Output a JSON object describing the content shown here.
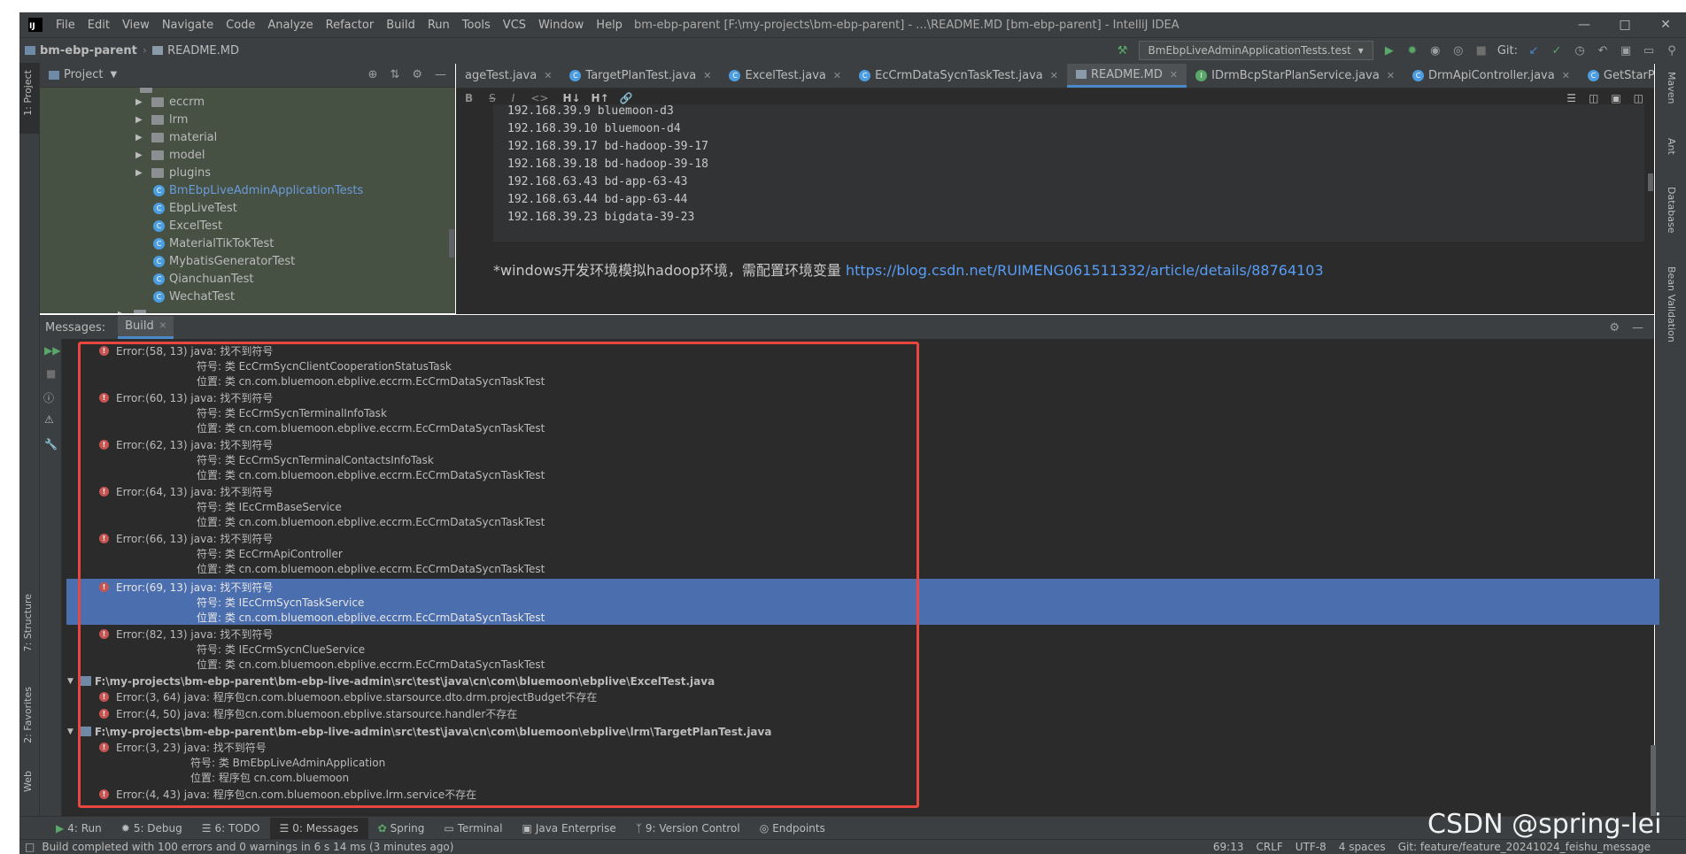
{
  "window": {
    "title": "bm-ebp-parent [F:\\my-projects\\bm-ebp-parent] - ...\\README.MD [bm-ebp-parent] - IntelliJ IDEA",
    "menu": [
      "File",
      "Edit",
      "View",
      "Navigate",
      "Code",
      "Analyze",
      "Refactor",
      "Build",
      "Run",
      "Tools",
      "VCS",
      "Window",
      "Help"
    ]
  },
  "navbar": {
    "project": "bm-ebp-parent",
    "file": "README.MD",
    "run_config": "BmEbpLiveAdminApplicationTests.test",
    "git_label": "Git:"
  },
  "left_strip": {
    "project": "1: Project",
    "structure": "7: Structure",
    "favorites": "2: Favorites",
    "web": "Web"
  },
  "right_strip": {
    "maven": "Maven",
    "ant": "Ant",
    "database": "Database",
    "bean": "Bean Validation"
  },
  "project_panel": {
    "title": "Project",
    "folders": [
      "eccrm",
      "lrm",
      "material",
      "model",
      "plugins"
    ],
    "classes": [
      "BmEbpLiveAdminApplicationTests",
      "EbpLiveTest",
      "ExcelTest",
      "MaterialTikTokTest",
      "MybatisGeneratorTest",
      "QianchuanTest",
      "WechatTest"
    ]
  },
  "editor": {
    "tabs": [
      "ageTest.java",
      "TargetPlanTest.java",
      "ExcelTest.java",
      "EcCrmDataSycnTaskTest.java",
      "README.MD",
      "IDrmBcpStarPlanService.java",
      "DrmApiController.java",
      "GetStarPlanAuditorListVo.ja"
    ],
    "active_tab": "README.MD",
    "code_lines": [
      "192.168.39.9 bluemoon-d3",
      "192.168.39.10 bluemoon-d4",
      "192.168.39.17 bd-hadoop-39-17",
      "192.168.39.18 bd-hadoop-39-18",
      "192.168.63.43 bd-app-63-43",
      "192.168.63.44 bd-app-63-44",
      "192.168.39.23 bigdata-39-23"
    ],
    "note_text": "*windows开发环境模拟hadoop环境，需配置环境变量 ",
    "note_link": "https://blog.csdn.net/RUIMENG061511332/article/details/88764103"
  },
  "messages": {
    "label": "Messages:",
    "tab": "Build",
    "errors": [
      {
        "head": "Error:(58, 13)  java: 找不到符号",
        "sym": "符号:   类 EcCrmSycnClientCooperationStatusTask",
        "loc": "位置: 类 cn.com.bluemoon.ebplive.eccrm.EcCrmDataSycnTaskTest"
      },
      {
        "head": "Error:(60, 13)  java: 找不到符号",
        "sym": "符号:   类 EcCrmSycnTerminalInfoTask",
        "loc": "位置: 类 cn.com.bluemoon.ebplive.eccrm.EcCrmDataSycnTaskTest"
      },
      {
        "head": "Error:(62, 13)  java: 找不到符号",
        "sym": "符号:   类 EcCrmSycnTerminalContactsInfoTask",
        "loc": "位置: 类 cn.com.bluemoon.ebplive.eccrm.EcCrmDataSycnTaskTest"
      },
      {
        "head": "Error:(64, 13)  java: 找不到符号",
        "sym": "符号:   类 IEcCrmBaseService",
        "loc": "位置: 类 cn.com.bluemoon.ebplive.eccrm.EcCrmDataSycnTaskTest"
      },
      {
        "head": "Error:(66, 13)  java: 找不到符号",
        "sym": "符号:   类 EcCrmApiController",
        "loc": "位置: 类 cn.com.bluemoon.ebplive.eccrm.EcCrmDataSycnTaskTest"
      },
      {
        "head": "Error:(69, 13)  java: 找不到符号",
        "sym": "符号:   类 IEcCrmSycnTaskService",
        "loc": "位置: 类 cn.com.bluemoon.ebplive.eccrm.EcCrmDataSycnTaskTest"
      },
      {
        "head": "Error:(82, 13)  java: 找不到符号",
        "sym": "符号:   类 IEcCrmSycnClueService",
        "loc": "位置: 类 cn.com.bluemoon.ebplive.eccrm.EcCrmDataSycnTaskTest"
      }
    ],
    "file1": "F:\\my-projects\\bm-ebp-parent\\bm-ebp-live-admin\\src\\test\\java\\cn\\com\\bluemoon\\ebplive\\ExcelTest.java",
    "file1_errors": [
      "Error:(3, 64)  java: 程序包cn.com.bluemoon.ebplive.starsource.dto.drm.projectBudget不存在",
      "Error:(4, 50)  java: 程序包cn.com.bluemoon.ebplive.starsource.handler不存在"
    ],
    "file2": "F:\\my-projects\\bm-ebp-parent\\bm-ebp-live-admin\\src\\test\\java\\cn\\com\\bluemoon\\ebplive\\lrm\\TargetPlanTest.java",
    "file2_error_head": "Error:(3, 23)  java: 找不到符号",
    "file2_error_sym": "符号:   类 BmEbpLiveAdminApplication",
    "file2_error_loc": "位置: 程序包 cn.com.bluemoon",
    "file2_error_last": "Error:(4, 43)  java: 程序包cn.com.bluemoon.ebplive.lrm.service不存在"
  },
  "bottom_tabs": [
    "4: Run",
    "5: Debug",
    "6: TODO",
    "0: Messages",
    "Spring",
    "Terminal",
    "Java Enterprise",
    "9: Version Control",
    "Endpoints"
  ],
  "status": {
    "message": "Build completed with 100 errors and 0 warnings in 6 s 14 ms (3 minutes ago)",
    "position": "69:13",
    "line_sep": "CRLF",
    "encoding": "UTF-8",
    "indent": "4 spaces",
    "branch": "Git: feature/feature_20241024_feishu_message"
  },
  "watermark": "CSDN @spring-lei",
  "colors": {
    "error": "#c75450",
    "selection": "#4b6eaf",
    "highlight_box": "#e8463f",
    "link": "#589df6"
  }
}
